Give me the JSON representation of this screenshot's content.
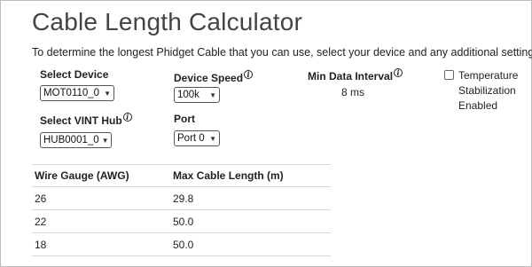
{
  "page": {
    "title": "Cable Length Calculator",
    "intro": "To determine the longest Phidget Cable that you can use, select your device and any additional settings."
  },
  "device": {
    "label": "Select Device",
    "selected": "MOT0110_0"
  },
  "device_speed": {
    "label": "Device Speed",
    "selected": "100k"
  },
  "min_data_interval": {
    "label": "Min Data Interval",
    "value": "8 ms"
  },
  "temperature": {
    "label": "Temperature Stabilization Enabled",
    "checked": false
  },
  "vint_hub": {
    "label": "Select VINT Hub",
    "selected": "HUB0001_0"
  },
  "port": {
    "label": "Port",
    "selected": "Port 0"
  },
  "table": {
    "headers": [
      "Wire Gauge (AWG)",
      "Max Cable Length (m)"
    ],
    "rows": [
      [
        "26",
        "29.8"
      ],
      [
        "22",
        "50.0"
      ],
      [
        "18",
        "50.0"
      ]
    ]
  },
  "icons": {
    "info": "info-icon",
    "dropdown": "chevron-down-icon"
  }
}
